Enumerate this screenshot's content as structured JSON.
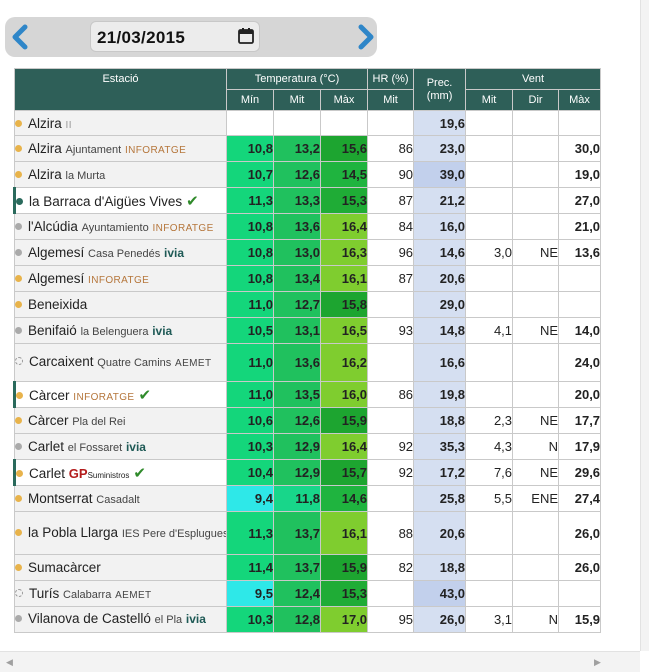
{
  "date": "21/03/2015",
  "headers": {
    "station": "Estació",
    "temp": "Temperatura (°C)",
    "hr": "HR (%)",
    "prec": "Prec.\n(mm)",
    "wind": "Vent",
    "tmin": "Mín",
    "tavg": "Mit",
    "tmax": "Màx",
    "hravg": "Mit",
    "wavg": "Mit",
    "wdir": "Dir",
    "wmax": "Màx"
  },
  "colors": {
    "header_bg": "#2e5f58",
    "prec_bg": "#d5dff1",
    "prec_high_bg": "#c2d0ec",
    "dot_orange": "#e8b34b",
    "dot_gray": "#aaaaaa",
    "dot_teal": "#2a6a5c",
    "check_green": "#2f8a2a",
    "gp_red": "#b31b1b"
  },
  "rows": [
    {
      "name": "Alzira",
      "sub": "",
      "src": "II",
      "src_color": "#999999",
      "dot": "orange",
      "check": false,
      "min": "",
      "avg": "",
      "max": "",
      "hr": "",
      "prec": "19,6",
      "wavg": "",
      "wdir": "",
      "wmax": "",
      "cmin": "",
      "cavg": "",
      "cmax": ""
    },
    {
      "name": "Alzira",
      "sub": "Ajuntament",
      "src": "INFORATGE",
      "src_color": "#b5763b",
      "dot": "orange",
      "check": false,
      "min": "10,8",
      "avg": "13,2",
      "max": "15,6",
      "hr": "86",
      "prec": "23,0",
      "wavg": "",
      "wdir": "",
      "wmax": "30,0",
      "cmin": "#14d67b",
      "cavg": "#20c15e",
      "cmax": "#1da530"
    },
    {
      "name": "Alzira",
      "sub": "la Murta",
      "src": "",
      "src_color": "",
      "dot": "orange",
      "check": false,
      "min": "10,7",
      "avg": "12,6",
      "max": "14,5",
      "hr": "90",
      "prec": "39,0",
      "wavg": "",
      "wdir": "",
      "wmax": "19,0",
      "cmin": "#14d67b",
      "cavg": "#20c15e",
      "cmax": "#1fb43f"
    },
    {
      "name": "la Barraca d'Aigües Vives",
      "sub": "",
      "src": "",
      "src_color": "",
      "dot": "teal",
      "check": true,
      "min": "11,3",
      "avg": "13,3",
      "max": "15,3",
      "hr": "87",
      "prec": "21,2",
      "wavg": "",
      "wdir": "",
      "wmax": "27,0",
      "cmin": "#14d67b",
      "cavg": "#20c15e",
      "cmax": "#1fac36"
    },
    {
      "name": "l'Alcúdia",
      "sub": "Ayuntamiento",
      "src": "INFORATGE",
      "src_color": "#b5763b",
      "dot": "gray",
      "check": false,
      "min": "10,8",
      "avg": "13,6",
      "max": "16,4",
      "hr": "84",
      "prec": "16,0",
      "wavg": "",
      "wdir": "",
      "wmax": "21,0",
      "cmin": "#14d67b",
      "cavg": "#20c15e",
      "cmax": "#7fcd2f"
    },
    {
      "name": "Algemesí",
      "sub": "Casa Penedés",
      "src": "ivia",
      "src_color": "ivia",
      "dot": "gray",
      "check": false,
      "min": "10,8",
      "avg": "13,0",
      "max": "16,3",
      "hr": "96",
      "prec": "14,6",
      "wavg": "3,0",
      "wdir": "NE",
      "wmax": "13,6",
      "cmin": "#14d67b",
      "cavg": "#20c15e",
      "cmax": "#7fcd2f"
    },
    {
      "name": "Algemesí",
      "sub": "",
      "src": "INFORATGE",
      "src_color": "#b5763b",
      "dot": "orange",
      "check": false,
      "min": "10,8",
      "avg": "13,4",
      "max": "16,1",
      "hr": "87",
      "prec": "20,6",
      "wavg": "",
      "wdir": "",
      "wmax": "",
      "cmin": "#14d67b",
      "cavg": "#20c15e",
      "cmax": "#7fcd2f"
    },
    {
      "name": "Beneixida",
      "sub": "",
      "src": "",
      "src_color": "",
      "dot": "orange",
      "check": false,
      "min": "11,0",
      "avg": "12,7",
      "max": "15,8",
      "hr": "",
      "prec": "29,0",
      "wavg": "",
      "wdir": "",
      "wmax": "",
      "cmin": "#14d67b",
      "cavg": "#20c15e",
      "cmax": "#1da530"
    },
    {
      "name": "Benifaió",
      "sub": "la Belenguera",
      "src": "ivia",
      "src_color": "ivia",
      "dot": "gray",
      "check": false,
      "min": "10,5",
      "avg": "13,1",
      "max": "16,5",
      "hr": "93",
      "prec": "14,8",
      "wavg": "4,1",
      "wdir": "NE",
      "wmax": "14,0",
      "cmin": "#14d67b",
      "cavg": "#20c15e",
      "cmax": "#7fcd2f"
    },
    {
      "name": "Carcaixent",
      "sub": "Quatre Camins",
      "src": "AEMET",
      "src_color": "#444444",
      "dot": "dashed",
      "check": false,
      "min": "11,0",
      "avg": "13,6",
      "max": "16,2",
      "hr": "",
      "prec": "16,6",
      "wavg": "",
      "wdir": "",
      "wmax": "24,0",
      "cmin": "#14d67b",
      "cavg": "#20c15e",
      "cmax": "#7fcd2f"
    },
    {
      "name": "Càrcer",
      "sub": "",
      "src": "INFORATGE",
      "src_color": "#b5763b",
      "dot": "orange",
      "check": true,
      "min": "11,0",
      "avg": "13,5",
      "max": "16,0",
      "hr": "86",
      "prec": "19,8",
      "wavg": "",
      "wdir": "",
      "wmax": "20,0",
      "cmin": "#14d67b",
      "cavg": "#20c15e",
      "cmax": "#7fcd2f"
    },
    {
      "name": "Càrcer",
      "sub": "Pla del Rei",
      "src": "",
      "src_color": "",
      "dot": "orange",
      "check": false,
      "min": "10,6",
      "avg": "12,6",
      "max": "15,9",
      "hr": "",
      "prec": "18,8",
      "wavg": "2,3",
      "wdir": "NE",
      "wmax": "17,7",
      "cmin": "#14d67b",
      "cavg": "#20c15e",
      "cmax": "#1da530"
    },
    {
      "name": "Carlet",
      "sub": "el Fossaret",
      "src": "ivia",
      "src_color": "ivia",
      "dot": "gray",
      "check": false,
      "min": "10,3",
      "avg": "12,9",
      "max": "16,4",
      "hr": "92",
      "prec": "35,3",
      "wavg": "4,3",
      "wdir": "N",
      "wmax": "17,9",
      "cmin": "#14d67b",
      "cavg": "#20c15e",
      "cmax": "#7fcd2f"
    },
    {
      "name": "Carlet",
      "sub": "",
      "src": "GP",
      "src_color": "gp",
      "dot": "orange",
      "check": true,
      "min": "10,4",
      "avg": "12,9",
      "max": "15,7",
      "hr": "92",
      "prec": "17,2",
      "wavg": "7,6",
      "wdir": "NE",
      "wmax": "29,6",
      "cmin": "#14d67b",
      "cavg": "#20c15e",
      "cmax": "#1da530"
    },
    {
      "name": "Montserrat",
      "sub": "Casadalt",
      "src": "",
      "src_color": "",
      "dot": "orange",
      "check": false,
      "min": "9,4",
      "avg": "11,8",
      "max": "14,6",
      "hr": "",
      "prec": "25,8",
      "wavg": "5,5",
      "wdir": "ENE",
      "wmax": "27,4",
      "cmin": "#2ee8e8",
      "cavg": "#18d68a",
      "cmax": "#1fb43f"
    },
    {
      "name": "la Pobla Llarga",
      "sub": "IES Pere d'Esplugues",
      "src": "",
      "src_color": "",
      "dot": "orange",
      "check": false,
      "min": "11,3",
      "avg": "13,7",
      "max": "16,1",
      "hr": "88",
      "prec": "20,6",
      "wavg": "",
      "wdir": "",
      "wmax": "26,0",
      "cmin": "#14d67b",
      "cavg": "#20c15e",
      "cmax": "#7fcd2f"
    },
    {
      "name": "Sumacàrcer",
      "sub": "",
      "src": "",
      "src_color": "",
      "dot": "orange",
      "check": false,
      "min": "11,4",
      "avg": "13,7",
      "max": "15,9",
      "hr": "82",
      "prec": "18,8",
      "wavg": "",
      "wdir": "",
      "wmax": "26,0",
      "cmin": "#14d67b",
      "cavg": "#20c15e",
      "cmax": "#1da530"
    },
    {
      "name": "Turís",
      "sub": "Calabarra",
      "src": "AEMET",
      "src_color": "#444444",
      "dot": "dashed",
      "check": false,
      "min": "9,5",
      "avg": "12,4",
      "max": "15,3",
      "hr": "",
      "prec": "43,0",
      "wavg": "",
      "wdir": "",
      "wmax": "",
      "cmin": "#2ee8e8",
      "cavg": "#20c15e",
      "cmax": "#1fac36"
    },
    {
      "name": "Vilanova de Castelló",
      "sub": "el Pla",
      "src": "ivia",
      "src_color": "ivia",
      "dot": "gray",
      "check": false,
      "min": "10,3",
      "avg": "12,8",
      "max": "17,0",
      "hr": "95",
      "prec": "26,0",
      "wavg": "3,1",
      "wdir": "N",
      "wmax": "15,9",
      "cmin": "#14d67b",
      "cavg": "#20c15e",
      "cmax": "#7fcd2f"
    }
  ],
  "row_heights": [
    25,
    26,
    26,
    26,
    26,
    26,
    26,
    26,
    26,
    38,
    26,
    26,
    26,
    26,
    26,
    43,
    26,
    26,
    26
  ],
  "selected_rows": [
    3,
    10,
    13
  ],
  "gp_suffix": "Suministros"
}
